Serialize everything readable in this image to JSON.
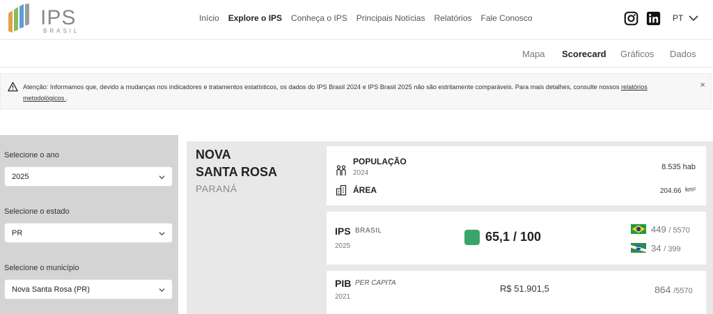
{
  "header": {
    "logo_text": "IPS",
    "logo_sub": "BRASIL",
    "nav": [
      "Início",
      "Explore o IPS",
      "Conheça o IPS",
      "Principais Notícias",
      "Relatórios",
      "Fale Conosco"
    ],
    "active_nav": "Explore o IPS",
    "language": "PT",
    "icons": [
      "instagram-icon",
      "linkedin-icon"
    ]
  },
  "subtabs": {
    "items": [
      "Mapa",
      "Scorecard",
      "Gráficos",
      "Dados"
    ],
    "active": "Scorecard"
  },
  "alert": {
    "text": "Atenção: Informamos que, devido a mudanças nos indicadores e tratamentos estatísticos, os dados do IPS Brasil 2024 e IPS Brasil 2025 não são estritamente comparáveis. Para mais detalhes, consulte nossos ",
    "link_text": "relatórios metodológicos ",
    "suffix": ".",
    "close": "×"
  },
  "filters": {
    "year_label": "Selecione o ano",
    "year_value": "2025",
    "state_label": "Selecione o estado",
    "state_value": "PR",
    "city_label": "Selecione o município",
    "city_value": "Nova Santa Rosa (PR)"
  },
  "municipio": {
    "name_line1": "NOVA",
    "name_line2": "SANTA ROSA",
    "state": "PARANÁ"
  },
  "populacao": {
    "title": "POPULAÇÃO",
    "year": "2024",
    "value": "8.535 hab"
  },
  "area": {
    "title": "ÁREA",
    "value": "204.66",
    "unit": "km²"
  },
  "ips": {
    "title": "IPS",
    "brand": "BRASIL",
    "year": "2025",
    "score": "65,1 / 100",
    "score_color": "#3aa56a",
    "rank_brasil": "449",
    "rank_brasil_total": "/ 5570",
    "rank_estado": "34",
    "rank_estado_total": "/ 399"
  },
  "pib": {
    "title": "PIB",
    "per": "PER CAPITA",
    "year": "2021",
    "value": "R$ 51.901,5",
    "rank": "864",
    "rank_total": "/5570"
  }
}
